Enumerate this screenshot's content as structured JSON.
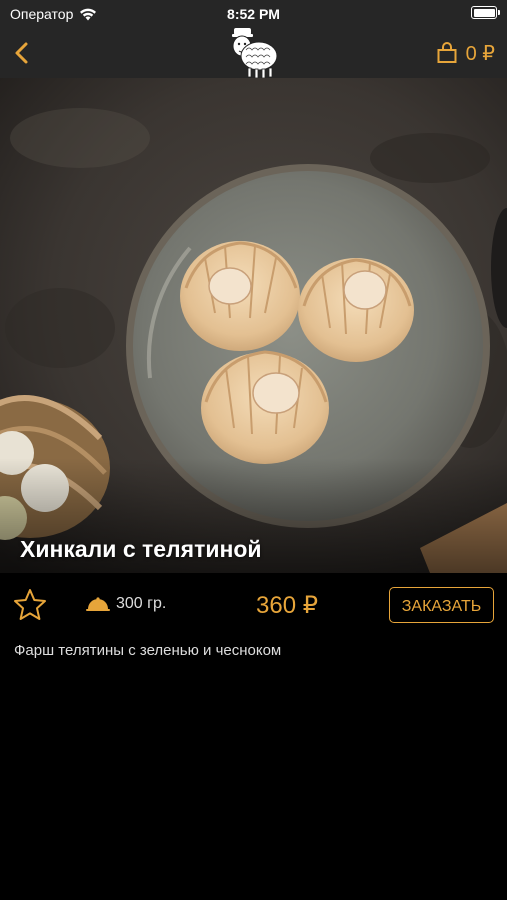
{
  "status_bar": {
    "carrier": "Оператор",
    "time": "8:52 PM"
  },
  "nav": {
    "cart_count": "0 ₽",
    "accent_color": "#e7a53a"
  },
  "dish": {
    "title": "Хинкали с телятиной",
    "weight": "300 гр.",
    "price": "360 ₽",
    "order_label": "ЗАКАЗАТЬ",
    "description": "Фарш телятины с зеленью и чесноком"
  }
}
